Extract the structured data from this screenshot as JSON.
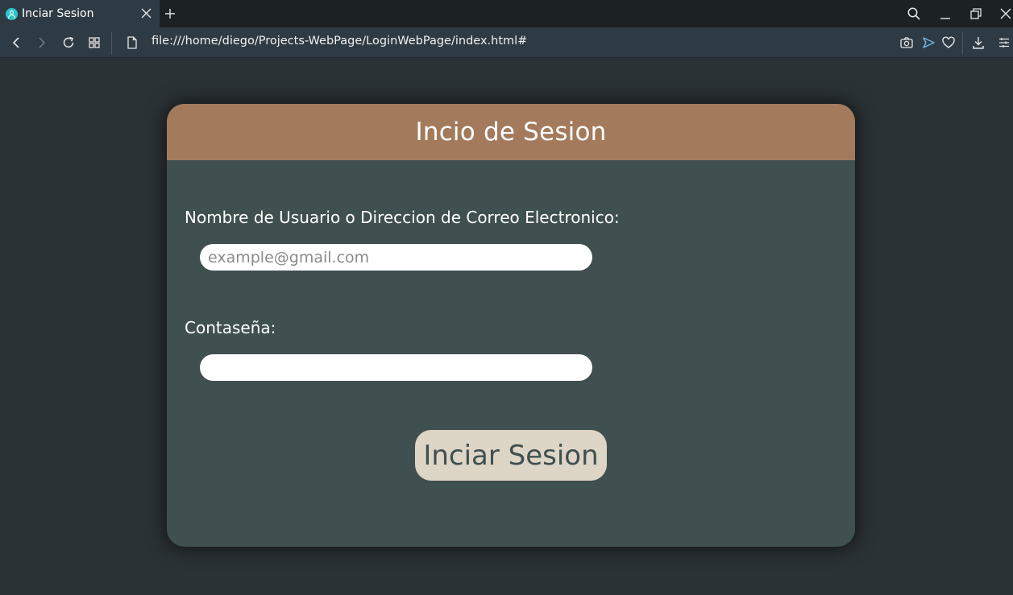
{
  "browser": {
    "tab": {
      "title": "Inciar Sesion"
    },
    "address_bar": {
      "url": "file:///home/diego/Projects-WebPage/LoginWebPage/index.html#"
    }
  },
  "login_card": {
    "title": "Incio de Sesion",
    "username": {
      "label": "Nombre de Usuario o Direccion de Correo Electronico:",
      "placeholder": "example@gmail.com",
      "value": ""
    },
    "password": {
      "label": "Contaseña:",
      "value": ""
    },
    "submit_label": "Inciar Sesion"
  },
  "colors": {
    "page_background": "#2b3235",
    "card_background": "#404f4f",
    "card_header": "#a37a5c",
    "button_background": "#ddd5c6",
    "favicon": "#2ec5c9"
  },
  "icons": [
    "user-icon",
    "close-icon",
    "plus-icon",
    "search-icon",
    "minimize-icon",
    "restore-icon",
    "back-icon",
    "forward-icon",
    "reload-icon",
    "grid-icon",
    "file-icon",
    "camera-icon",
    "send-icon",
    "heart-icon",
    "download-icon",
    "menu-icon"
  ]
}
